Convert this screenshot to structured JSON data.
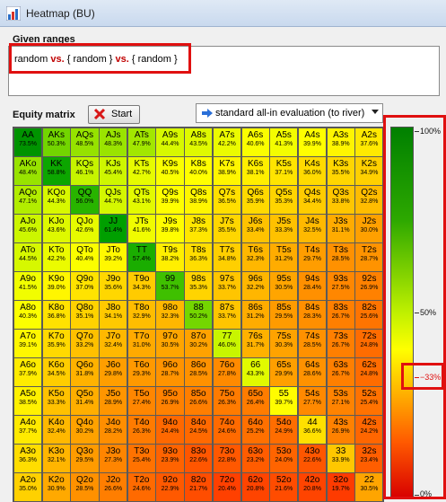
{
  "window": {
    "title": "Heatmap (BU)"
  },
  "given_ranges": {
    "label": "Given ranges",
    "parts": [
      "random",
      "vs.",
      "{ random }",
      "vs.",
      "{ random }"
    ]
  },
  "equity_matrix": {
    "label": "Equity matrix"
  },
  "start_button": {
    "label": "Start"
  },
  "evaluation_select": {
    "value": "standard all-in evaluation (to river)"
  },
  "legend": {
    "labels": [
      "100%",
      "50%",
      "0%"
    ],
    "marker_label": "33%",
    "marker_value": 0.33
  },
  "colors": {
    "highlight": "#e01010",
    "vs": "#c00000"
  },
  "icons": [
    "app-heatmap-icon",
    "red-x-icon",
    "blue-arrow-icon",
    "dropdown-arrow-icon"
  ],
  "matrix": {
    "rows": [
      [
        [
          "AA",
          "73.5%"
        ],
        [
          "AKs",
          "50.3%"
        ],
        [
          "AQs",
          "48.5%"
        ],
        [
          "AJs",
          "48.3%"
        ],
        [
          "ATs",
          "47.9%"
        ],
        [
          "A9s",
          "44.4%"
        ],
        [
          "A8s",
          "43.5%"
        ],
        [
          "A7s",
          "42.2%"
        ],
        [
          "A6s",
          "40.6%"
        ],
        [
          "A5s",
          "41.3%"
        ],
        [
          "A4s",
          "39.9%"
        ],
        [
          "A3s",
          "38.9%"
        ],
        [
          "A2s",
          "37.6%"
        ]
      ],
      [
        [
          "AKo",
          "48.4%"
        ],
        [
          "KK",
          "58.8%"
        ],
        [
          "KQs",
          "46.1%"
        ],
        [
          "KJs",
          "45.4%"
        ],
        [
          "KTs",
          "42.7%"
        ],
        [
          "K9s",
          "40.5%"
        ],
        [
          "K8s",
          "40.0%"
        ],
        [
          "K7s",
          "38.9%"
        ],
        [
          "K6s",
          "38.1%"
        ],
        [
          "K5s",
          "37.1%"
        ],
        [
          "K4s",
          "36.0%"
        ],
        [
          "K3s",
          "35.5%"
        ],
        [
          "K2s",
          "34.9%"
        ]
      ],
      [
        [
          "AQo",
          "47.1%"
        ],
        [
          "KQo",
          "44.3%"
        ],
        [
          "QQ",
          "56.0%"
        ],
        [
          "QJs",
          "44.7%"
        ],
        [
          "QTs",
          "43.1%"
        ],
        [
          "Q9s",
          "39.9%"
        ],
        [
          "Q8s",
          "38.9%"
        ],
        [
          "Q7s",
          "36.5%"
        ],
        [
          "Q6s",
          "35.9%"
        ],
        [
          "Q5s",
          "35.3%"
        ],
        [
          "Q4s",
          "34.4%"
        ],
        [
          "Q3s",
          "33.8%"
        ],
        [
          "Q2s",
          "32.8%"
        ]
      ],
      [
        [
          "AJo",
          "45.6%"
        ],
        [
          "KJo",
          "43.6%"
        ],
        [
          "QJo",
          "42.6%"
        ],
        [
          "JJ",
          "61.4%"
        ],
        [
          "JTs",
          "41.6%"
        ],
        [
          "J9s",
          "39.8%"
        ],
        [
          "J8s",
          "37.3%"
        ],
        [
          "J7s",
          "35.5%"
        ],
        [
          "J6s",
          "33.4%"
        ],
        [
          "J5s",
          "33.3%"
        ],
        [
          "J4s",
          "32.5%"
        ],
        [
          "J3s",
          "31.1%"
        ],
        [
          "J2s",
          "30.0%"
        ]
      ],
      [
        [
          "ATo",
          "44.5%"
        ],
        [
          "KTo",
          "42.2%"
        ],
        [
          "QTo",
          "40.4%"
        ],
        [
          "JTo",
          "39.2%"
        ],
        [
          "TT",
          "57.4%"
        ],
        [
          "T9s",
          "38.2%"
        ],
        [
          "T8s",
          "36.3%"
        ],
        [
          "T7s",
          "34.8%"
        ],
        [
          "T6s",
          "32.3%"
        ],
        [
          "T5s",
          "31.2%"
        ],
        [
          "T4s",
          "29.7%"
        ],
        [
          "T3s",
          "28.5%"
        ],
        [
          "T2s",
          "28.7%"
        ]
      ],
      [
        [
          "A9o",
          "41.5%"
        ],
        [
          "K9o",
          "39.0%"
        ],
        [
          "Q9o",
          "37.0%"
        ],
        [
          "J9o",
          "35.6%"
        ],
        [
          "T9o",
          "34.3%"
        ],
        [
          "99",
          "53.7%"
        ],
        [
          "98s",
          "35.3%"
        ],
        [
          "97s",
          "33.7%"
        ],
        [
          "96s",
          "32.2%"
        ],
        [
          "95s",
          "30.5%"
        ],
        [
          "94s",
          "28.4%"
        ],
        [
          "93s",
          "27.5%"
        ],
        [
          "92s",
          "26.9%"
        ]
      ],
      [
        [
          "A8o",
          "40.3%"
        ],
        [
          "K8o",
          "36.8%"
        ],
        [
          "Q8o",
          "35.1%"
        ],
        [
          "J8o",
          "34.1%"
        ],
        [
          "T8o",
          "32.9%"
        ],
        [
          "98o",
          "32.3%"
        ],
        [
          "88",
          "50.2%"
        ],
        [
          "87s",
          "33.7%"
        ],
        [
          "86s",
          "31.2%"
        ],
        [
          "85s",
          "29.5%"
        ],
        [
          "84s",
          "28.3%"
        ],
        [
          "83s",
          "26.7%"
        ],
        [
          "82s",
          "25.6%"
        ]
      ],
      [
        [
          "A7o",
          "39.1%"
        ],
        [
          "K7o",
          "35.9%"
        ],
        [
          "Q7o",
          "33.2%"
        ],
        [
          "J7o",
          "32.4%"
        ],
        [
          "T7o",
          "31.0%"
        ],
        [
          "97o",
          "30.5%"
        ],
        [
          "87o",
          "30.2%"
        ],
        [
          "77",
          "46.0%"
        ],
        [
          "76s",
          "31.7%"
        ],
        [
          "75s",
          "30.3%"
        ],
        [
          "74s",
          "28.5%"
        ],
        [
          "73s",
          "26.7%"
        ],
        [
          "72s",
          "24.8%"
        ]
      ],
      [
        [
          "A6o",
          "37.9%"
        ],
        [
          "K6o",
          "34.5%"
        ],
        [
          "Q6o",
          "31.8%"
        ],
        [
          "J6o",
          "29.8%"
        ],
        [
          "T6o",
          "29.3%"
        ],
        [
          "96o",
          "28.7%"
        ],
        [
          "86o",
          "28.5%"
        ],
        [
          "76o",
          "27.8%"
        ],
        [
          "66",
          "43.3%"
        ],
        [
          "65s",
          "29.9%"
        ],
        [
          "64s",
          "28.6%"
        ],
        [
          "63s",
          "26.7%"
        ],
        [
          "62s",
          "24.8%"
        ]
      ],
      [
        [
          "A5o",
          "38.5%"
        ],
        [
          "K5o",
          "33.3%"
        ],
        [
          "Q5o",
          "31.4%"
        ],
        [
          "J5o",
          "28.9%"
        ],
        [
          "T5o",
          "27.4%"
        ],
        [
          "95o",
          "26.9%"
        ],
        [
          "85o",
          "26.6%"
        ],
        [
          "75o",
          "26.3%"
        ],
        [
          "65o",
          "26.4%"
        ],
        [
          "55",
          "39.7%"
        ],
        [
          "54s",
          "27.7%"
        ],
        [
          "53s",
          "27.1%"
        ],
        [
          "52s",
          "25.4%"
        ]
      ],
      [
        [
          "A4o",
          "37.7%"
        ],
        [
          "K4o",
          "32.4%"
        ],
        [
          "Q4o",
          "30.2%"
        ],
        [
          "J4o",
          "28.2%"
        ],
        [
          "T4o",
          "26.3%"
        ],
        [
          "94o",
          "24.4%"
        ],
        [
          "84o",
          "24.5%"
        ],
        [
          "74o",
          "24.6%"
        ],
        [
          "64o",
          "25.2%"
        ],
        [
          "54o",
          "24.9%"
        ],
        [
          "44",
          "36.6%"
        ],
        [
          "43s",
          "26.9%"
        ],
        [
          "42s",
          "24.2%"
        ]
      ],
      [
        [
          "A3o",
          "36.3%"
        ],
        [
          "K3o",
          "32.1%"
        ],
        [
          "Q3o",
          "29.5%"
        ],
        [
          "J3o",
          "27.3%"
        ],
        [
          "T3o",
          "25.4%"
        ],
        [
          "93o",
          "23.9%"
        ],
        [
          "83o",
          "22.6%"
        ],
        [
          "73o",
          "22.8%"
        ],
        [
          "63o",
          "23.2%"
        ],
        [
          "53o",
          "24.0%"
        ],
        [
          "43o",
          "22.6%"
        ],
        [
          "33",
          "33.9%"
        ],
        [
          "32s",
          "23.4%"
        ]
      ],
      [
        [
          "A2o",
          "35.0%"
        ],
        [
          "K2o",
          "30.9%"
        ],
        [
          "Q2o",
          "28.5%"
        ],
        [
          "J2o",
          "26.6%"
        ],
        [
          "T2o",
          "24.6%"
        ],
        [
          "92o",
          "22.9%"
        ],
        [
          "82o",
          "21.7%"
        ],
        [
          "72o",
          "20.4%"
        ],
        [
          "62o",
          "20.8%"
        ],
        [
          "52o",
          "21.6%"
        ],
        [
          "42o",
          "20.8%"
        ],
        [
          "32o",
          "19.7%"
        ],
        [
          "22",
          "30.5%"
        ]
      ]
    ]
  }
}
